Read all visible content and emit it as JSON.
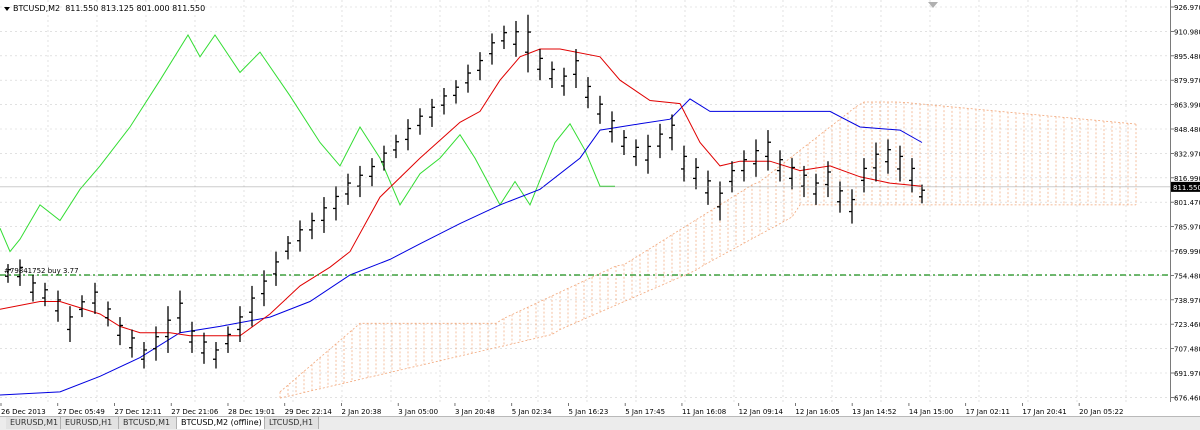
{
  "header": {
    "symbol": "BTCUSD,M2",
    "quote": "811.550 813.125 801.000 811.550"
  },
  "order_label": "#79841752 buy 3.77",
  "price_axis": {
    "ticks": [
      "926.970",
      "910.980",
      "895.480",
      "879.970",
      "863.990",
      "848.480",
      "832.970",
      "816.990",
      "801.470",
      "785.970",
      "769.990",
      "754.480",
      "738.970",
      "723.460",
      "707.480",
      "691.970",
      "676.460"
    ],
    "current": "811.550"
  },
  "time_axis": {
    "labels": [
      "26 Dec 2013",
      "27 Dec 05:49",
      "27 Dec 12:11",
      "27 Dec 21:06",
      "28 Dec 19:01",
      "29 Dec 22:14",
      "2 Jan 20:38",
      "3 Jan 05:00",
      "3 Jan 20:48",
      "5 Jan 02:34",
      "5 Jan 16:23",
      "5 Jan 17:45",
      "11 Jan 16:08",
      "12 Jan 09:14",
      "12 Jan 16:05",
      "13 Jan 14:52",
      "14 Jan 15:00",
      "17 Jan 02:11",
      "17 Jan 20:41",
      "20 Jan 05:22"
    ]
  },
  "tabs": [
    {
      "label": "EURUSD,M1",
      "active": false
    },
    {
      "label": "EURUSD,H1",
      "active": false
    },
    {
      "label": "BTCUSD,M1",
      "active": false
    },
    {
      "label": "BTCUSD,M2 (offline)",
      "active": true
    },
    {
      "label": "LTCUSD,H1",
      "active": false
    }
  ],
  "colors": {
    "candles": "#000000",
    "tenkan": "#e00000",
    "kijun": "#0000e0",
    "chikou": "#33dd33",
    "cloud": "#f2a77a",
    "order_line": "#1a8f1a",
    "grid": "#d0d0d0",
    "background": "#ffffff"
  }
}
